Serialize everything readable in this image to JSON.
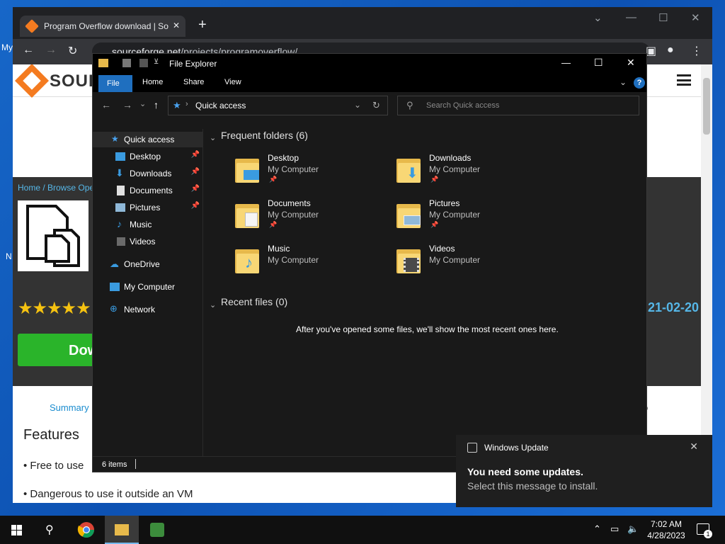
{
  "desktop": {
    "icon_labels": [
      "My",
      "N"
    ]
  },
  "chrome": {
    "tab_title": "Program Overflow download | So",
    "tab_close": "✕",
    "new_tab": "+",
    "url_domain": "sourceforge.net",
    "url_path": "/projects/programoverflow/",
    "page": {
      "brand": "SOUR",
      "breadcrumb": "Home / Browse Ope",
      "stars": "★★★★★",
      "download_label": "Dow",
      "date_fragment": "21-02-20",
      "summary_tab": "Summary",
      "right_fragment": "o",
      "features_heading": "Features",
      "features": [
        "• Free to use",
        "• Dangerous to use it outside an VM"
      ]
    }
  },
  "explorer": {
    "title": "File Explorer",
    "ribbon": {
      "file": "File",
      "home": "Home",
      "share": "Share",
      "view": "View",
      "help": "?"
    },
    "address": "Quick access",
    "search_placeholder": "Search Quick access",
    "nav": [
      {
        "label": "Quick access",
        "pinned": false
      },
      {
        "label": "Desktop",
        "pinned": true
      },
      {
        "label": "Downloads",
        "pinned": true
      },
      {
        "label": "Documents",
        "pinned": true
      },
      {
        "label": "Pictures",
        "pinned": true
      },
      {
        "label": "Music",
        "pinned": false
      },
      {
        "label": "Videos",
        "pinned": false
      },
      {
        "label": "OneDrive",
        "pinned": false
      },
      {
        "label": "My Computer",
        "pinned": false
      },
      {
        "label": "Network",
        "pinned": false
      }
    ],
    "frequent_heading": "Frequent folders (6)",
    "folders": [
      {
        "name": "Desktop",
        "location": "My Computer",
        "pinned": true
      },
      {
        "name": "Downloads",
        "location": "My Computer",
        "pinned": true
      },
      {
        "name": "Documents",
        "location": "My Computer",
        "pinned": true
      },
      {
        "name": "Pictures",
        "location": "My Computer",
        "pinned": true
      },
      {
        "name": "Music",
        "location": "My Computer",
        "pinned": false
      },
      {
        "name": "Videos",
        "location": "My Computer",
        "pinned": false
      }
    ],
    "recent_heading": "Recent files (0)",
    "recent_empty": "After you've opened some files, we'll show the most recent ones here.",
    "status": "6 items"
  },
  "toast": {
    "app": "Windows Update",
    "heading": "You need some updates.",
    "body": "Select this message to install.",
    "close": "✕"
  },
  "taskbar": {
    "time": "7:02 AM",
    "date": "4/28/2023",
    "notification_count": "1"
  },
  "colors": {
    "accent": "#1f6fbf",
    "sourceforge": "#f47b20",
    "download_green": "#2ab42a",
    "link_blue": "#56b7e8"
  }
}
